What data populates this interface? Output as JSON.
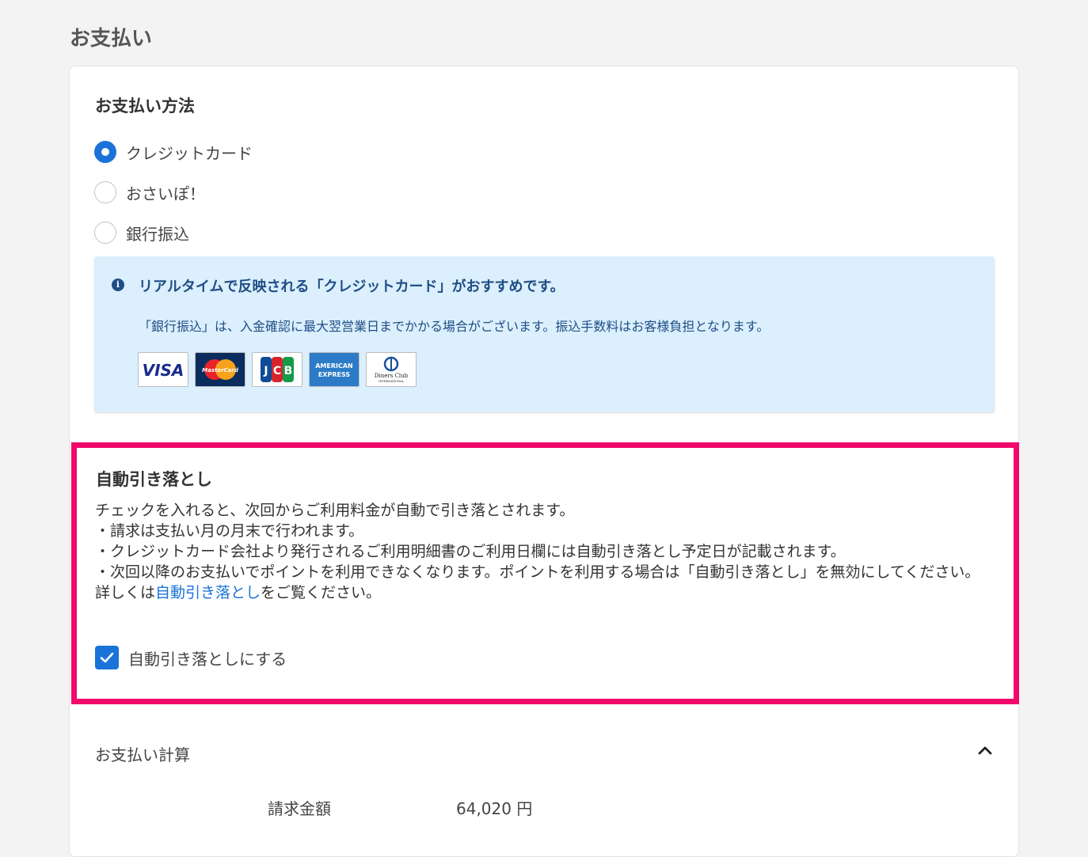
{
  "page": {
    "title": "お支払い"
  },
  "payment_method": {
    "title": "お支払い方法",
    "options": [
      {
        "label": "クレジットカード",
        "checked": true
      },
      {
        "label": "おさいぽ！",
        "checked": false
      },
      {
        "label": "銀行振込",
        "checked": false
      }
    ]
  },
  "info": {
    "heading": "リアルタイムで反映される「クレジットカード」がおすすめです。",
    "text": "「銀行振込」は、入金確認に最大翌営業日までかかる場合がございます。振込手数料はお客様負担となります。",
    "card_brands": [
      "VISA",
      "MasterCard",
      "JCB",
      "AMERICAN EXPRESS",
      "Diners Club INTERNATIONAL"
    ]
  },
  "auto_debit": {
    "title": "自動引き落とし",
    "lines": [
      "チェックを入れると、次回からご利用料金が自動で引き落とされます。",
      "・請求は支払い月の月末で行われます。",
      "・クレジットカード会社より発行されるご利用明細書のご利用日欄には自動引き落とし予定日が記載されます。",
      "・次回以降のお支払いでポイントを利用できなくなります。ポイントを利用する場合は「自動引き落とし」を無効にしてください。"
    ],
    "detail_prefix": "詳しくは",
    "detail_link": "自動引き落とし",
    "detail_suffix": "をご覧ください。",
    "checkbox_label": "自動引き落としにする",
    "checked": true
  },
  "calculation": {
    "title": "お支払い計算",
    "bill_label": "請求金額",
    "bill_value": "64,020 円"
  },
  "colors": {
    "accent": "#1a73d9",
    "highlight_border": "#f0086a",
    "info_bg": "#dbeffc",
    "info_text": "#1f4d86"
  }
}
